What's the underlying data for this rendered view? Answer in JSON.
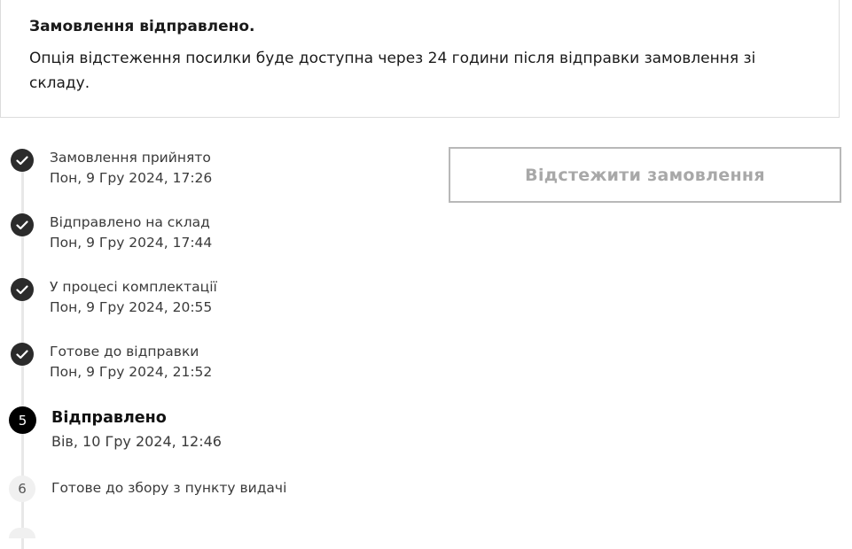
{
  "notice": {
    "title": "Замовлення відправлено.",
    "text": "Опція відстеження посилки буде доступна через 24 години після відправки замовлення зі складу."
  },
  "track_button": {
    "label": "Відстежити замовлення"
  },
  "steps": [
    {
      "status": "done",
      "icon": "check-icon",
      "label": "Замовлення прийнято",
      "date": "Пон, 9 Гру 2024, 17:26"
    },
    {
      "status": "done",
      "icon": "check-icon",
      "label": "Відправлено на склад",
      "date": "Пон, 9 Гру 2024, 17:44"
    },
    {
      "status": "done",
      "icon": "check-icon",
      "label": "У процесі комплектації",
      "date": "Пон, 9 Гру 2024, 20:55"
    },
    {
      "status": "done",
      "icon": "check-icon",
      "label": "Готове до відправки",
      "date": "Пон, 9 Гру 2024, 21:52"
    },
    {
      "status": "current",
      "number": "5",
      "label": "Відправлено",
      "date": "Вів, 10 Гру 2024, 12:46"
    },
    {
      "status": "pending",
      "number": "6",
      "label": "Готове до збору з пункту видачі"
    }
  ],
  "colors": {
    "done_icon": "#2b2b2b",
    "current_icon": "#000000",
    "pending_icon": "#f0f0f0",
    "button_border": "#b8b8b8",
    "button_text": "#a8a8a8"
  }
}
